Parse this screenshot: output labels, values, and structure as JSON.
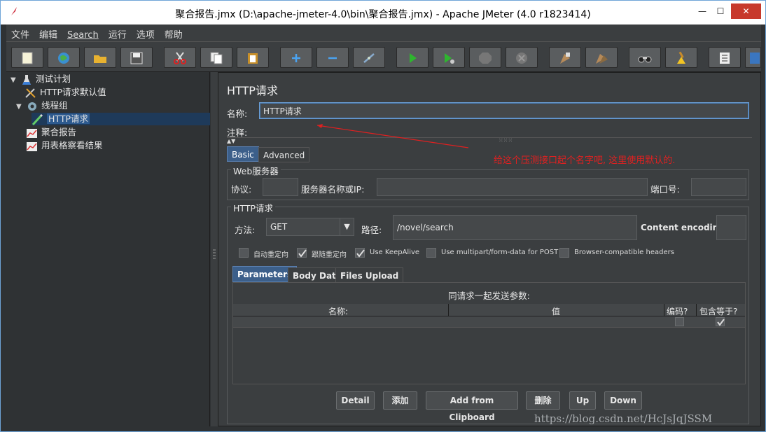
{
  "window": {
    "title": "聚合报告.jmx (D:\\apache-jmeter-4.0\\bin\\聚合报告.jmx) - Apache JMeter (4.0 r1823414)",
    "min_label": "—",
    "max_label": "☐",
    "close_label": "✕"
  },
  "menu": [
    "文件",
    "编辑",
    "Search",
    "运行",
    "选项",
    "帮助"
  ],
  "toolbar": {
    "icons": [
      "new-icon",
      "templates-icon",
      "open-icon",
      "save-icon",
      "cut-icon",
      "copy-icon",
      "paste-icon",
      "expand-icon",
      "collapse-icon",
      "toggle-icon",
      "start-icon",
      "start-no-pause-icon",
      "stop-icon",
      "shutdown-icon",
      "clear-icon",
      "clear-all-icon",
      "search-icon",
      "reset-search-icon",
      "function-helper-icon",
      "help-icon"
    ]
  },
  "tree": {
    "items": [
      {
        "label": "测试计划",
        "icon": "flask-icon"
      },
      {
        "label": "HTTP请求默认值",
        "icon": "tools-icon"
      },
      {
        "label": "线程组",
        "icon": "gear-icon"
      },
      {
        "label": "HTTP请求",
        "icon": "pipette-icon"
      },
      {
        "label": "聚合报告",
        "icon": "chart-icon"
      },
      {
        "label": "用表格察看结果",
        "icon": "chart-icon"
      }
    ]
  },
  "panel": {
    "heading": "HTTP请求",
    "name_label": "名称:",
    "name_value": "HTTP请求",
    "comment_label": "注释:",
    "comment_value": "",
    "tabs": [
      "Basic",
      "Advanced"
    ],
    "web_server": {
      "title": "Web服务器",
      "protocol_label": "协议:",
      "protocol_value": "",
      "server_label": "服务器名称或IP:",
      "server_value": "",
      "port_label": "端口号:",
      "port_value": ""
    },
    "http_request": {
      "title": "HTTP请求",
      "method_label": "方法:",
      "method_value": "GET",
      "path_label": "路径:",
      "path_value": "/novel/search",
      "encoding_label": "Content encoding:",
      "encoding_value": ""
    },
    "checkboxes": [
      {
        "label": "自动重定向",
        "checked": false
      },
      {
        "label": "跟随重定向",
        "checked": true
      },
      {
        "label": "Use KeepAlive",
        "checked": true
      },
      {
        "label": "Use multipart/form-data for POST",
        "checked": false
      },
      {
        "label": "Browser-compatible headers",
        "checked": false
      }
    ],
    "param_tabs": [
      "Parameters",
      "Body Data",
      "Files Upload"
    ],
    "table": {
      "caption": "同请求一起发送参数:",
      "columns": [
        "名称:",
        "值",
        "编码?",
        "包含等于?"
      ],
      "row": {
        "name": "",
        "value": "",
        "encode": false,
        "include_equals": true
      }
    },
    "buttons": [
      "Detail",
      "添加",
      "Add from Clipboard",
      "删除",
      "Up",
      "Down"
    ]
  },
  "annotation": "给这个压测接口起个名字吧, 这里使用默认的.",
  "watermark": "https://blog.csdn.net/HcJsJqJSSM",
  "colors": {
    "accent": "#2d5a8f",
    "annotation": "#e02020"
  }
}
